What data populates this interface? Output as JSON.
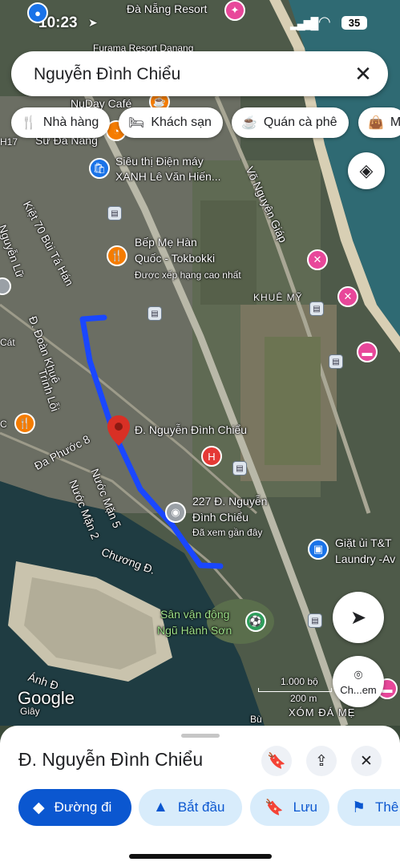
{
  "status_bar": {
    "time": "10:23",
    "battery": "35"
  },
  "search": {
    "query": "Nguyễn Đình Chiểu"
  },
  "chips": [
    {
      "icon": "restaurant-icon",
      "label": "Nhà hàng"
    },
    {
      "icon": "hotel-icon",
      "label": "Khách sạn"
    },
    {
      "icon": "coffee-icon",
      "label": "Quán cà phê"
    },
    {
      "icon": "shopping-bag-icon",
      "label": "M"
    }
  ],
  "map_labels": {
    "danang_resort": "Đà Nẵng Resort",
    "furama": "Furama Resort Danang",
    "nuday": "NuDay Café",
    "su_danang": "Sư Đà Nẵng",
    "h17": "H17",
    "dmx_line1": "Siêu thị Điện máy",
    "dmx_line2": "XANH Lê Văn Hiến...",
    "vo_nguyen_giap": "Võ Nguyên Giáp",
    "kiet70": "Kiệt 70 Bùi Tá Hán",
    "nguyen_lu": "Nguyễn Lữ",
    "bep_line1": "Bếp Mẹ Hàn",
    "bep_line2": "Quốc - Tokbokki",
    "bep_sub": "Được xếp hạng cao nhất",
    "khue_my": "KHUÊ MỸ",
    "doan_khue": "Đ. Đoàn Khuê",
    "trinh_loi": "Trình Lỗi",
    "cat": "Cát",
    "c": "C",
    "pin_label": "Đ. Nguyễn Đình Chiểu",
    "da_phuoc": "Đa Phước 8",
    "nuoc_man5": "Nước Mặn 5",
    "nuoc_man2": "Nước Mặn 2",
    "addr_line1": "227 Đ. Nguyễn",
    "addr_line2": "Đình Chiểu",
    "addr_sub": "Đã xem gần đây",
    "chuong": "Chương Đ.",
    "laundry_line1": "Giặt ủi T&T",
    "laundry_line2": "Laundry -Av",
    "stadium_line1": "Sân vận động",
    "stadium_line2": "Ngũ Hành Sơn",
    "anh_d": "Ánh Đ",
    "google": "Google",
    "giay": "Giây",
    "scale_ft": "1.000 bộ",
    "scale_m": "200 m",
    "xom_da_me": "XÓM ĐÁ MẸ",
    "check_in": "Ch...em",
    "bu": "Bù"
  },
  "sheet": {
    "title": "Đ. Nguyễn Đình Chiểu",
    "actions": [
      {
        "icon": "directions-icon",
        "label": "Đường đi"
      },
      {
        "icon": "navigation-icon",
        "label": "Bắt đầu"
      },
      {
        "icon": "bookmark-icon",
        "label": "Lưu"
      },
      {
        "icon": "flag-icon",
        "label": "Thê"
      }
    ]
  },
  "colors": {
    "route": "#1a47ff",
    "pin": "#d93025",
    "primary": "#0b57d0",
    "chip_bg": "#ffffff"
  }
}
